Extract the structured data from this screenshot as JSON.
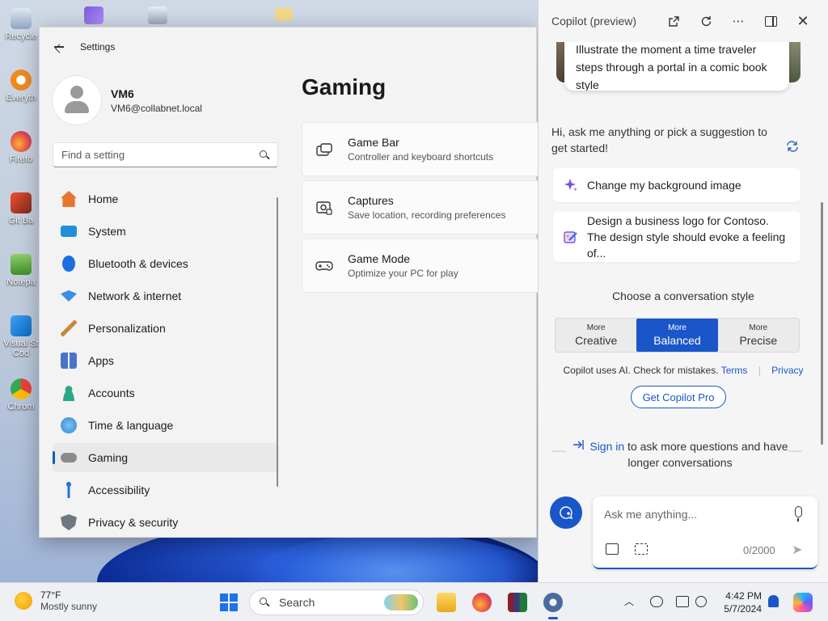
{
  "desktop": {
    "icons": [
      "Recycle",
      "Everyth",
      "Firefo",
      "Git Ba",
      "Notepa",
      "Visual St Cod",
      "Chrom"
    ]
  },
  "settings": {
    "app_title": "Settings",
    "user": {
      "name": "VM6",
      "email": "VM6@collabnet.local"
    },
    "search_placeholder": "Find a setting",
    "nav": [
      {
        "label": "Home",
        "icon": "home-icon",
        "color": "#e8742e"
      },
      {
        "label": "System",
        "icon": "monitor-icon",
        "color": "#1f8fd6"
      },
      {
        "label": "Bluetooth & devices",
        "icon": "bluetooth-icon",
        "color": "#1a6fe0"
      },
      {
        "label": "Network & internet",
        "icon": "wifi-icon",
        "color": "#3c8de8"
      },
      {
        "label": "Personalization",
        "icon": "brush-icon",
        "color": "#c9873c"
      },
      {
        "label": "Apps",
        "icon": "apps-icon",
        "color": "#4b74c9"
      },
      {
        "label": "Accounts",
        "icon": "person-icon",
        "color": "#2aa88a"
      },
      {
        "label": "Time & language",
        "icon": "globe-clock-icon",
        "color": "#2f86cf"
      },
      {
        "label": "Gaming",
        "icon": "gamepad-icon",
        "color": "#8a8a8a"
      },
      {
        "label": "Accessibility",
        "icon": "accessibility-icon",
        "color": "#1d74d8"
      },
      {
        "label": "Privacy & security",
        "icon": "shield-icon",
        "color": "#6f7780"
      }
    ],
    "active_nav": "Gaming",
    "page_title": "Gaming",
    "cards": [
      {
        "title": "Game Bar",
        "subtitle": "Controller and keyboard shortcuts",
        "icon": "game-bar-icon"
      },
      {
        "title": "Captures",
        "subtitle": "Save location, recording preferences",
        "icon": "capture-icon"
      },
      {
        "title": "Game Mode",
        "subtitle": "Optimize your PC for play",
        "icon": "game-mode-icon"
      }
    ]
  },
  "copilot": {
    "title": "Copilot (preview)",
    "bubble_text": "Illustrate the moment a time traveler steps through a portal in a comic book style",
    "greeting": "Hi, ask me anything or pick a suggestion to get started!",
    "suggestions": [
      {
        "text": "Change my background image",
        "icon": "sparkle-icon"
      },
      {
        "text": "Design a business logo for Contoso. The design style should evoke a feeling of...",
        "icon": "paint-icon"
      }
    ],
    "style_label": "Choose a conversation style",
    "styles": [
      {
        "small": "More",
        "big": "Creative",
        "active": false
      },
      {
        "small": "More",
        "big": "Balanced",
        "active": true
      },
      {
        "small": "More",
        "big": "Precise",
        "active": false
      }
    ],
    "disclaimer": "Copilot uses AI. Check for mistakes.",
    "terms": "Terms",
    "privacy": "Privacy",
    "pro_button": "Get Copilot Pro",
    "signin_link": "Sign in",
    "signin_text": " to ask more questions and have longer conversations",
    "input_placeholder": "Ask me anything...",
    "counter": "0/2000",
    "accent": "#1a56c9"
  },
  "taskbar": {
    "weather_temp": "77°F",
    "weather_cond": "Mostly sunny",
    "search_label": "Search",
    "time": "4:42 PM",
    "date": "5/7/2024"
  }
}
